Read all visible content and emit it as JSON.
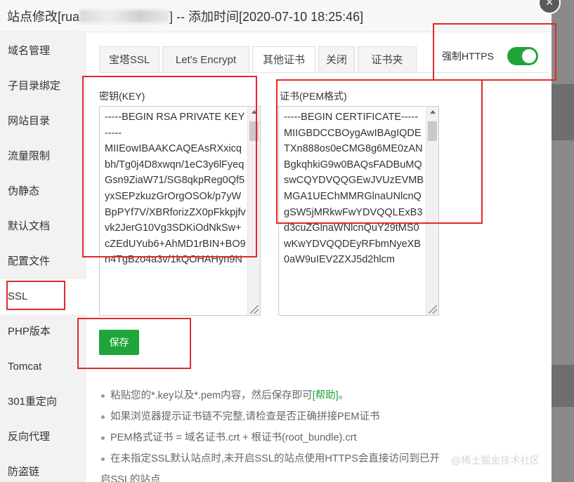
{
  "title": {
    "prefix": "站点修改[rua",
    "suffix": "] -- 添加时间[2020-07-10 18:25:46]"
  },
  "close_symbol": "×",
  "sidebar": {
    "items": [
      {
        "label": "域名管理"
      },
      {
        "label": "子目录绑定"
      },
      {
        "label": "网站目录"
      },
      {
        "label": "流量限制"
      },
      {
        "label": "伪静态"
      },
      {
        "label": "默认文档"
      },
      {
        "label": "配置文件"
      },
      {
        "label": "SSL",
        "active": true
      },
      {
        "label": "PHP版本"
      },
      {
        "label": "Tomcat"
      },
      {
        "label": "301重定向"
      },
      {
        "label": "反向代理"
      },
      {
        "label": "防盗链"
      }
    ]
  },
  "tabs": [
    {
      "label": "宝塔SSL"
    },
    {
      "label": "Let's Encrypt"
    },
    {
      "label": "其他证书",
      "active": true
    },
    {
      "label": "关闭"
    },
    {
      "label": "证书夹"
    }
  ],
  "force_https": {
    "label": "强制HTTPS",
    "enabled": true
  },
  "key_field": {
    "label": "密钥(KEY)",
    "value": "-----BEGIN RSA PRIVATE KEY-----\nMIIEowIBAAKCAQEAsRXxicqbh/Tg0j4D8xwqn/1eC3y6lFyeqGsn9ZiaW71/SG8qkpReg0Qf5yxSEPzkuzGrOrgOSOk/p7yWBpPYf7V/XBRforizZX0pFkkpjfvvk2JerG10Vg3SDKiOdNkSw+cZEdUYub6+AhMD1rBIN+BO9n4TgBzo4a3v/1kQOHAHyn9N"
  },
  "cert_field": {
    "label": "证书(PEM格式)",
    "value": "-----BEGIN CERTIFICATE-----\nMIIGBDCCBOygAwIBAgIQDETXn888os0eCMG8g6ME0zANBgkqhkiG9w0BAQsFADBuMQswCQYDVQQGEwJVUzEVMBMGA1UEChMMRGlnaUNlcnQgSW5jMRkwFwYDVQQLExB3d3cuZGlnaWNlcnQuY29tMS0wKwYDVQQDEyRFbmNyeXB0aW9uIEV2ZXJ5d2hlcm"
  },
  "save_label": "保存",
  "tips": {
    "t1_before": "粘贴您的*.key以及*.pem内容，然后保存即可",
    "t1_link": "[帮助]",
    "t1_after": "。",
    "t2": "如果浏览器提示证书链不完整,请检查是否正确拼接PEM证书",
    "t3": "PEM格式证书 = 域名证书.crt + 根证书(root_bundle).crt",
    "t4": "在未指定SSL默认站点时,未开启SSL的站点使用HTTPS会直接访问到已开启SSL的站点"
  },
  "watermark": "@稀土掘金技术社区",
  "colors": {
    "accent_green": "#20a53a",
    "annotation_red": "#e12a2a",
    "sidebar_bg": "#f2f2f2"
  }
}
